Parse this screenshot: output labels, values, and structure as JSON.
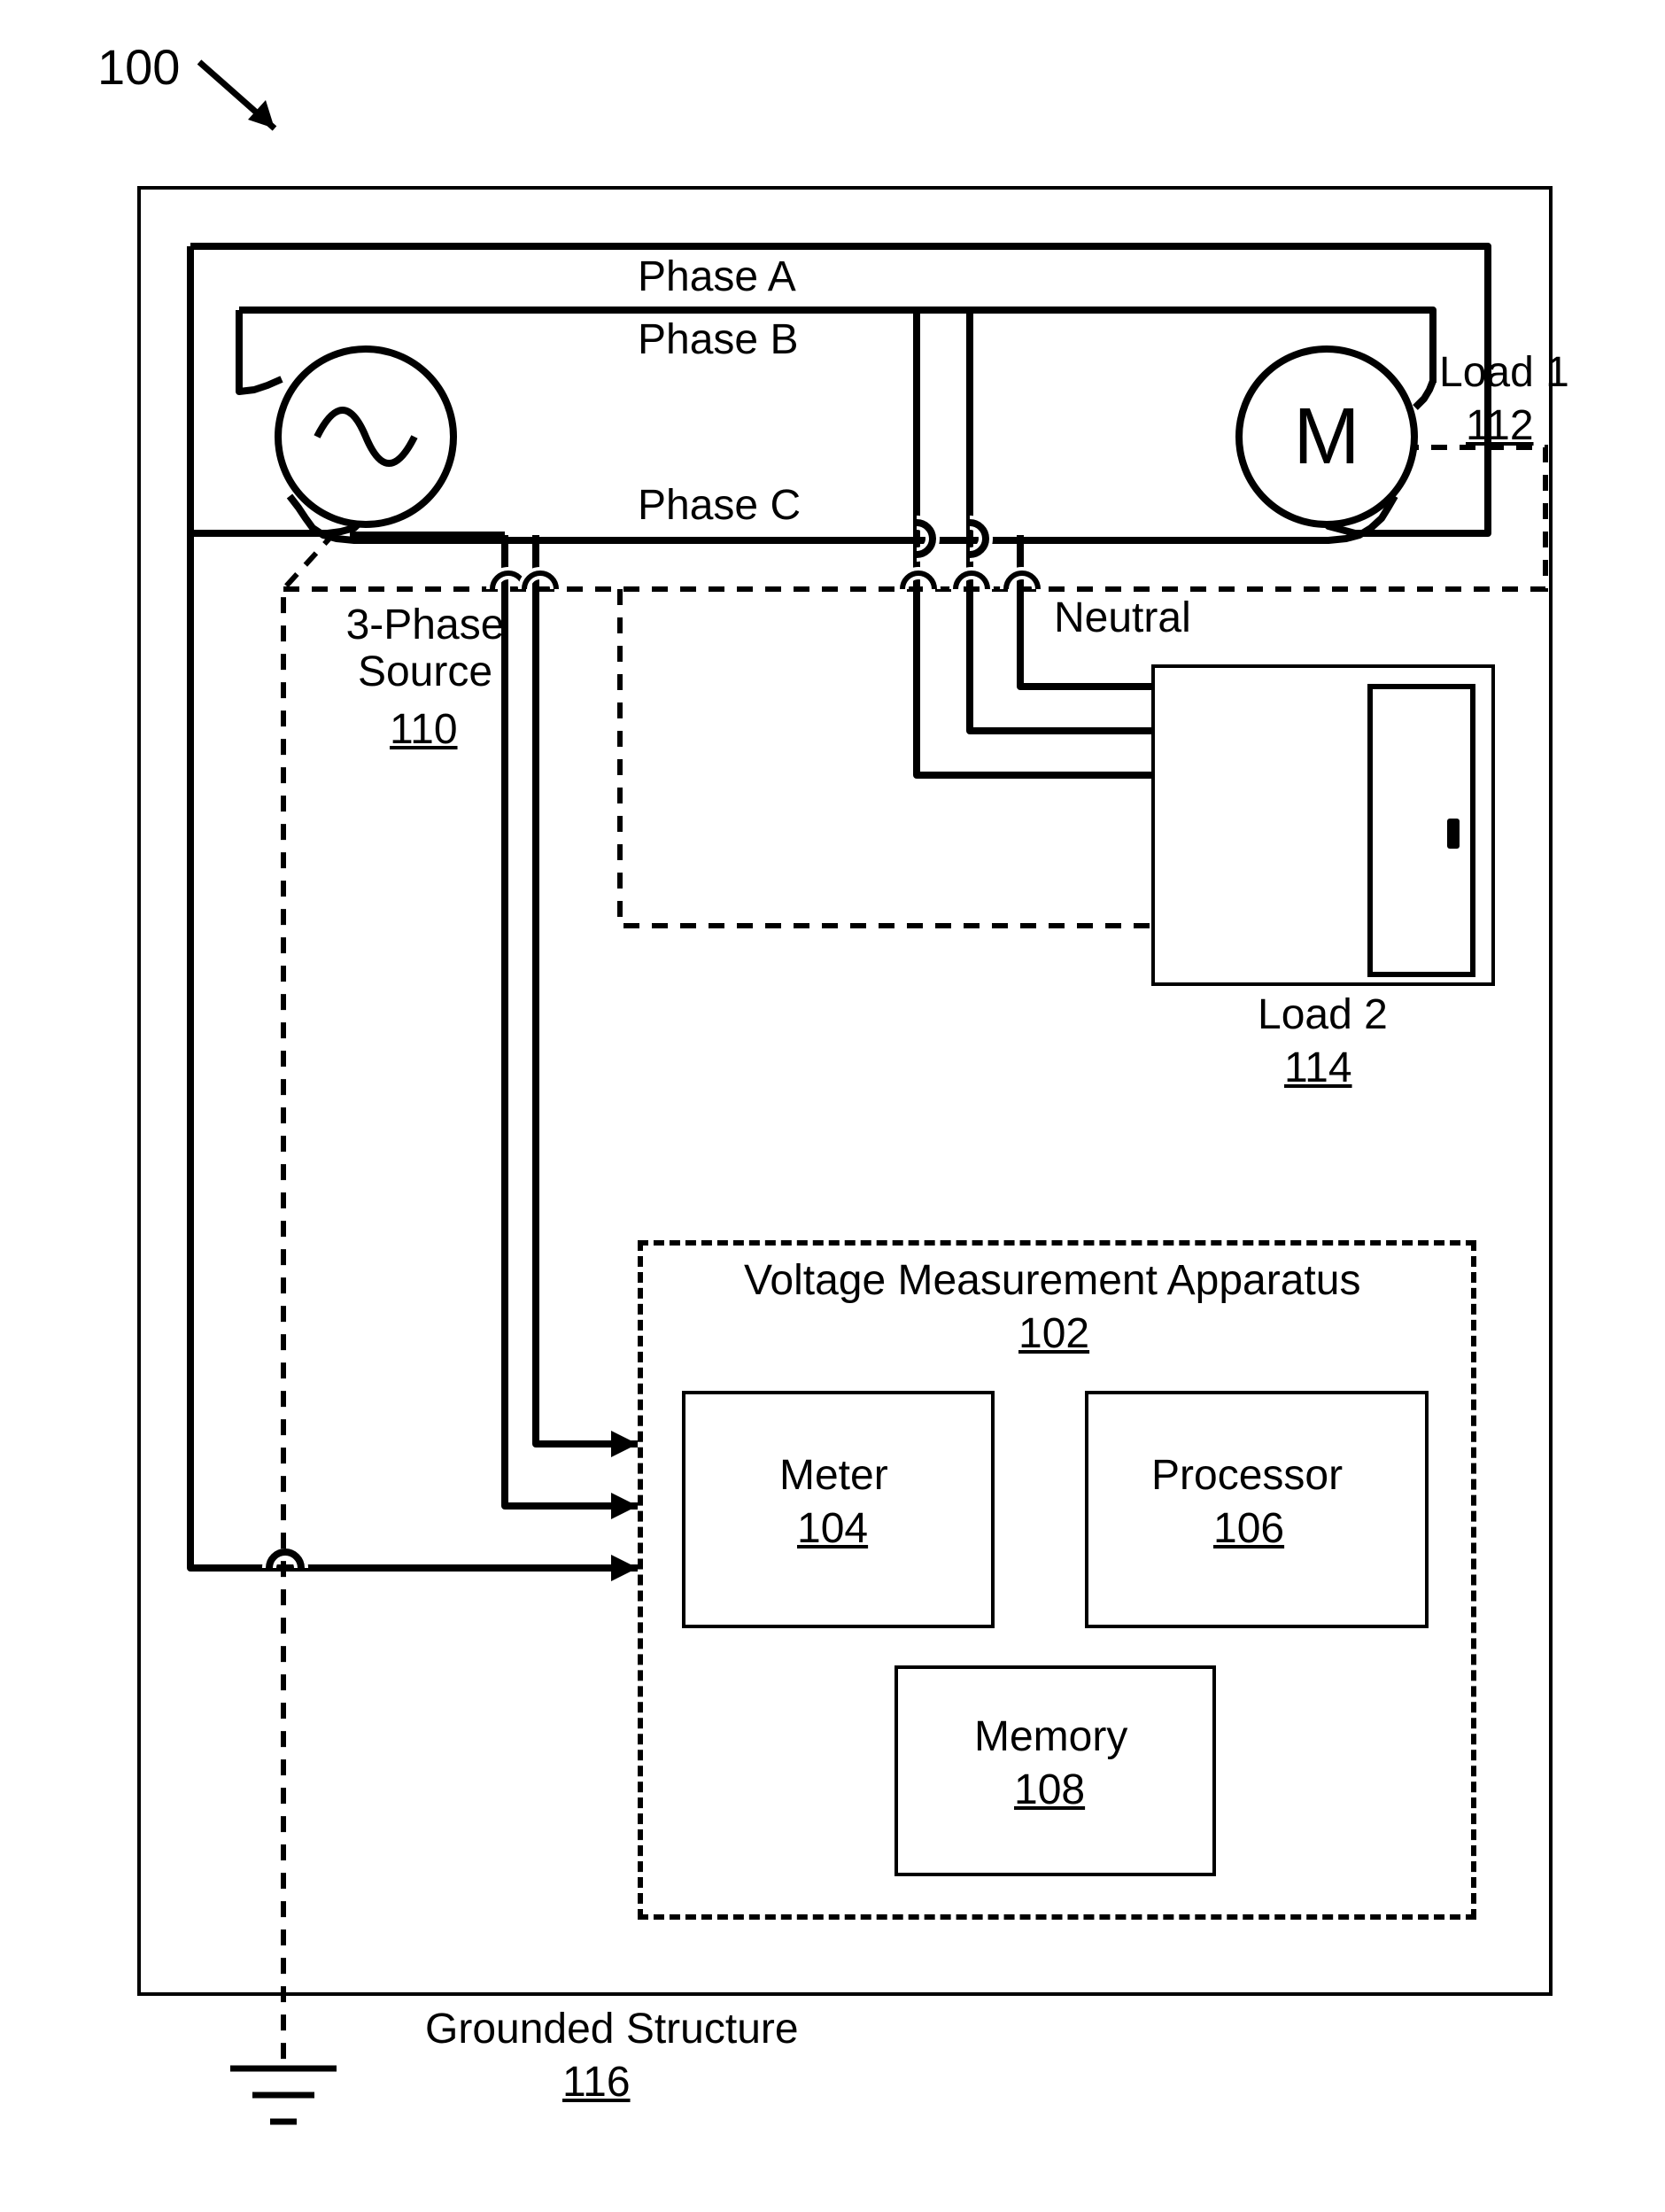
{
  "figure_ref": "100",
  "phases": {
    "a": "Phase A",
    "b": "Phase B",
    "c": "Phase C",
    "neutral": "Neutral"
  },
  "source": {
    "label": "3-Phase\nSource",
    "ref": "110"
  },
  "load1": {
    "label": "Load 1",
    "ref": "112",
    "symbol": "M"
  },
  "load2": {
    "label": "Load 2",
    "ref": "114"
  },
  "vma": {
    "title": "Voltage Measurement Apparatus",
    "ref": "102",
    "meter": {
      "label": "Meter",
      "ref": "104"
    },
    "processor": {
      "label": "Processor",
      "ref": "106"
    },
    "memory": {
      "label": "Memory",
      "ref": "108"
    }
  },
  "ground": {
    "label": "Grounded Structure",
    "ref": "116"
  }
}
